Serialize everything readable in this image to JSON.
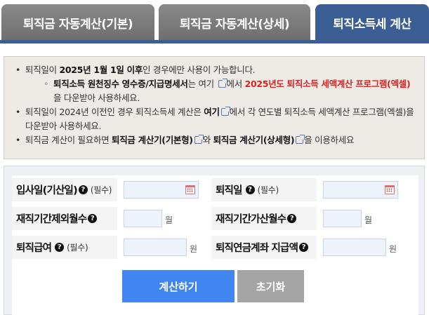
{
  "tabs": [
    {
      "label": "퇴직금 자동계산(기본)",
      "active": false
    },
    {
      "label": "퇴직금 자동계산(상세)",
      "active": false
    },
    {
      "label": "퇴직소득세 계산",
      "active": true
    }
  ],
  "notice": {
    "line1_pre": "퇴직일이 ",
    "line1_bold": "2025년 1월 1일 이후",
    "line1_post": "인 경우에만 사용이 가능합니다.",
    "line2_bold": "퇴직소득 원천징수 영수증/지급명세서",
    "line2_mid": "는 여기 ",
    "line2_after_link": "에서 ",
    "line2_red": "2025년도 퇴직소득 세액계산 프로그램(엑셀)",
    "line2_post": "을 다운받아 사용하세요.",
    "line3_pre": "퇴직일이 2024년 이전인 경우 퇴직소득세 계산은 ",
    "line3_bold": "여기",
    "line3_post": "에서 각 연도별 퇴직소득 세액계산 프로그램(엑셀)을 다운받아 사용하세요.",
    "line4_pre": "퇴직금 계산이 필요하면 ",
    "line4_bold1": "퇴직금 계산기(기본형)",
    "line4_mid": "와 ",
    "line4_bold2": "퇴직금 계산기(상세형)",
    "line4_post": "을 이용하세요"
  },
  "form": {
    "hire_date_label": "입사일(기산일)",
    "hire_date_required": "(필수)",
    "retire_date_label": "퇴직일",
    "retire_date_required": "(필수)",
    "excluded_months_label": "재직기간제외월수",
    "added_months_label": "재직기간가산월수",
    "month_unit": "월",
    "severance_label": "퇴직급여",
    "severance_required": "(필수)",
    "pension_label": "퇴직연금계좌 지급액",
    "won_unit": "원",
    "help_glyph": "?"
  },
  "buttons": {
    "calculate": "계산하기",
    "reset": "초기화"
  },
  "colors": {
    "active_tab": "#3b5f95",
    "calculate_button": "#3f86f1",
    "reset_button": "#a5a5a5",
    "highlight_red": "#e02020"
  }
}
